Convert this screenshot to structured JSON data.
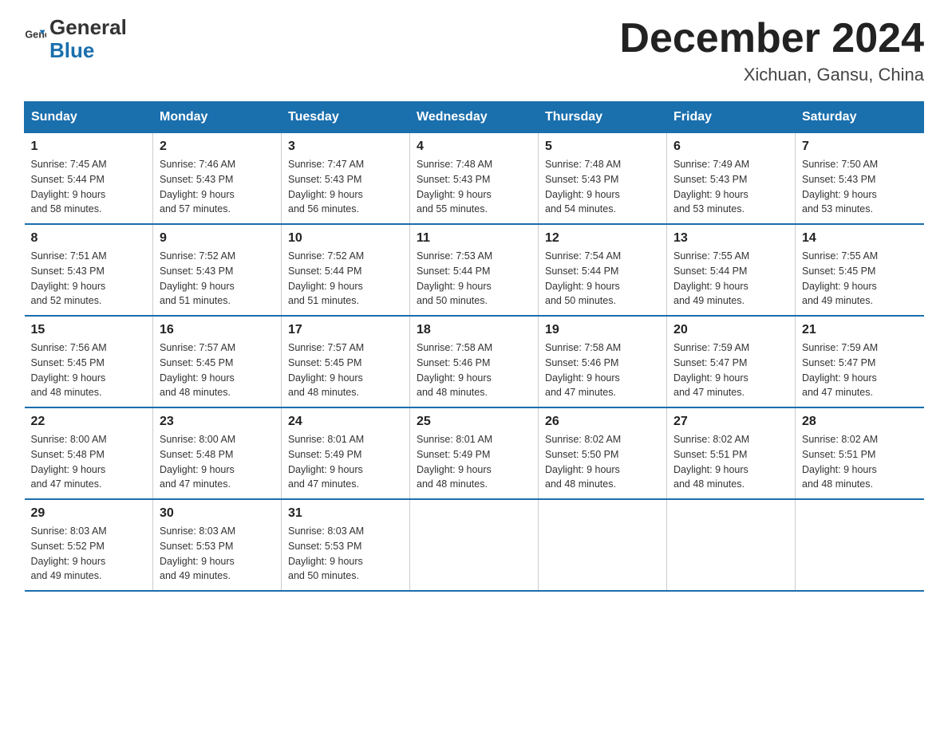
{
  "header": {
    "logo_general": "General",
    "logo_blue": "Blue",
    "month_title": "December 2024",
    "location": "Xichuan, Gansu, China"
  },
  "days_of_week": [
    "Sunday",
    "Monday",
    "Tuesday",
    "Wednesday",
    "Thursday",
    "Friday",
    "Saturday"
  ],
  "weeks": [
    [
      {
        "day": "1",
        "sunrise": "7:45 AM",
        "sunset": "5:44 PM",
        "daylight": "9 hours and 58 minutes."
      },
      {
        "day": "2",
        "sunrise": "7:46 AM",
        "sunset": "5:43 PM",
        "daylight": "9 hours and 57 minutes."
      },
      {
        "day": "3",
        "sunrise": "7:47 AM",
        "sunset": "5:43 PM",
        "daylight": "9 hours and 56 minutes."
      },
      {
        "day": "4",
        "sunrise": "7:48 AM",
        "sunset": "5:43 PM",
        "daylight": "9 hours and 55 minutes."
      },
      {
        "day": "5",
        "sunrise": "7:48 AM",
        "sunset": "5:43 PM",
        "daylight": "9 hours and 54 minutes."
      },
      {
        "day": "6",
        "sunrise": "7:49 AM",
        "sunset": "5:43 PM",
        "daylight": "9 hours and 53 minutes."
      },
      {
        "day": "7",
        "sunrise": "7:50 AM",
        "sunset": "5:43 PM",
        "daylight": "9 hours and 53 minutes."
      }
    ],
    [
      {
        "day": "8",
        "sunrise": "7:51 AM",
        "sunset": "5:43 PM",
        "daylight": "9 hours and 52 minutes."
      },
      {
        "day": "9",
        "sunrise": "7:52 AM",
        "sunset": "5:43 PM",
        "daylight": "9 hours and 51 minutes."
      },
      {
        "day": "10",
        "sunrise": "7:52 AM",
        "sunset": "5:44 PM",
        "daylight": "9 hours and 51 minutes."
      },
      {
        "day": "11",
        "sunrise": "7:53 AM",
        "sunset": "5:44 PM",
        "daylight": "9 hours and 50 minutes."
      },
      {
        "day": "12",
        "sunrise": "7:54 AM",
        "sunset": "5:44 PM",
        "daylight": "9 hours and 50 minutes."
      },
      {
        "day": "13",
        "sunrise": "7:55 AM",
        "sunset": "5:44 PM",
        "daylight": "9 hours and 49 minutes."
      },
      {
        "day": "14",
        "sunrise": "7:55 AM",
        "sunset": "5:45 PM",
        "daylight": "9 hours and 49 minutes."
      }
    ],
    [
      {
        "day": "15",
        "sunrise": "7:56 AM",
        "sunset": "5:45 PM",
        "daylight": "9 hours and 48 minutes."
      },
      {
        "day": "16",
        "sunrise": "7:57 AM",
        "sunset": "5:45 PM",
        "daylight": "9 hours and 48 minutes."
      },
      {
        "day": "17",
        "sunrise": "7:57 AM",
        "sunset": "5:45 PM",
        "daylight": "9 hours and 48 minutes."
      },
      {
        "day": "18",
        "sunrise": "7:58 AM",
        "sunset": "5:46 PM",
        "daylight": "9 hours and 48 minutes."
      },
      {
        "day": "19",
        "sunrise": "7:58 AM",
        "sunset": "5:46 PM",
        "daylight": "9 hours and 47 minutes."
      },
      {
        "day": "20",
        "sunrise": "7:59 AM",
        "sunset": "5:47 PM",
        "daylight": "9 hours and 47 minutes."
      },
      {
        "day": "21",
        "sunrise": "7:59 AM",
        "sunset": "5:47 PM",
        "daylight": "9 hours and 47 minutes."
      }
    ],
    [
      {
        "day": "22",
        "sunrise": "8:00 AM",
        "sunset": "5:48 PM",
        "daylight": "9 hours and 47 minutes."
      },
      {
        "day": "23",
        "sunrise": "8:00 AM",
        "sunset": "5:48 PM",
        "daylight": "9 hours and 47 minutes."
      },
      {
        "day": "24",
        "sunrise": "8:01 AM",
        "sunset": "5:49 PM",
        "daylight": "9 hours and 47 minutes."
      },
      {
        "day": "25",
        "sunrise": "8:01 AM",
        "sunset": "5:49 PM",
        "daylight": "9 hours and 48 minutes."
      },
      {
        "day": "26",
        "sunrise": "8:02 AM",
        "sunset": "5:50 PM",
        "daylight": "9 hours and 48 minutes."
      },
      {
        "day": "27",
        "sunrise": "8:02 AM",
        "sunset": "5:51 PM",
        "daylight": "9 hours and 48 minutes."
      },
      {
        "day": "28",
        "sunrise": "8:02 AM",
        "sunset": "5:51 PM",
        "daylight": "9 hours and 48 minutes."
      }
    ],
    [
      {
        "day": "29",
        "sunrise": "8:03 AM",
        "sunset": "5:52 PM",
        "daylight": "9 hours and 49 minutes."
      },
      {
        "day": "30",
        "sunrise": "8:03 AM",
        "sunset": "5:53 PM",
        "daylight": "9 hours and 49 minutes."
      },
      {
        "day": "31",
        "sunrise": "8:03 AM",
        "sunset": "5:53 PM",
        "daylight": "9 hours and 50 minutes."
      },
      null,
      null,
      null,
      null
    ]
  ],
  "labels": {
    "sunrise": "Sunrise:",
    "sunset": "Sunset:",
    "daylight": "Daylight:"
  }
}
